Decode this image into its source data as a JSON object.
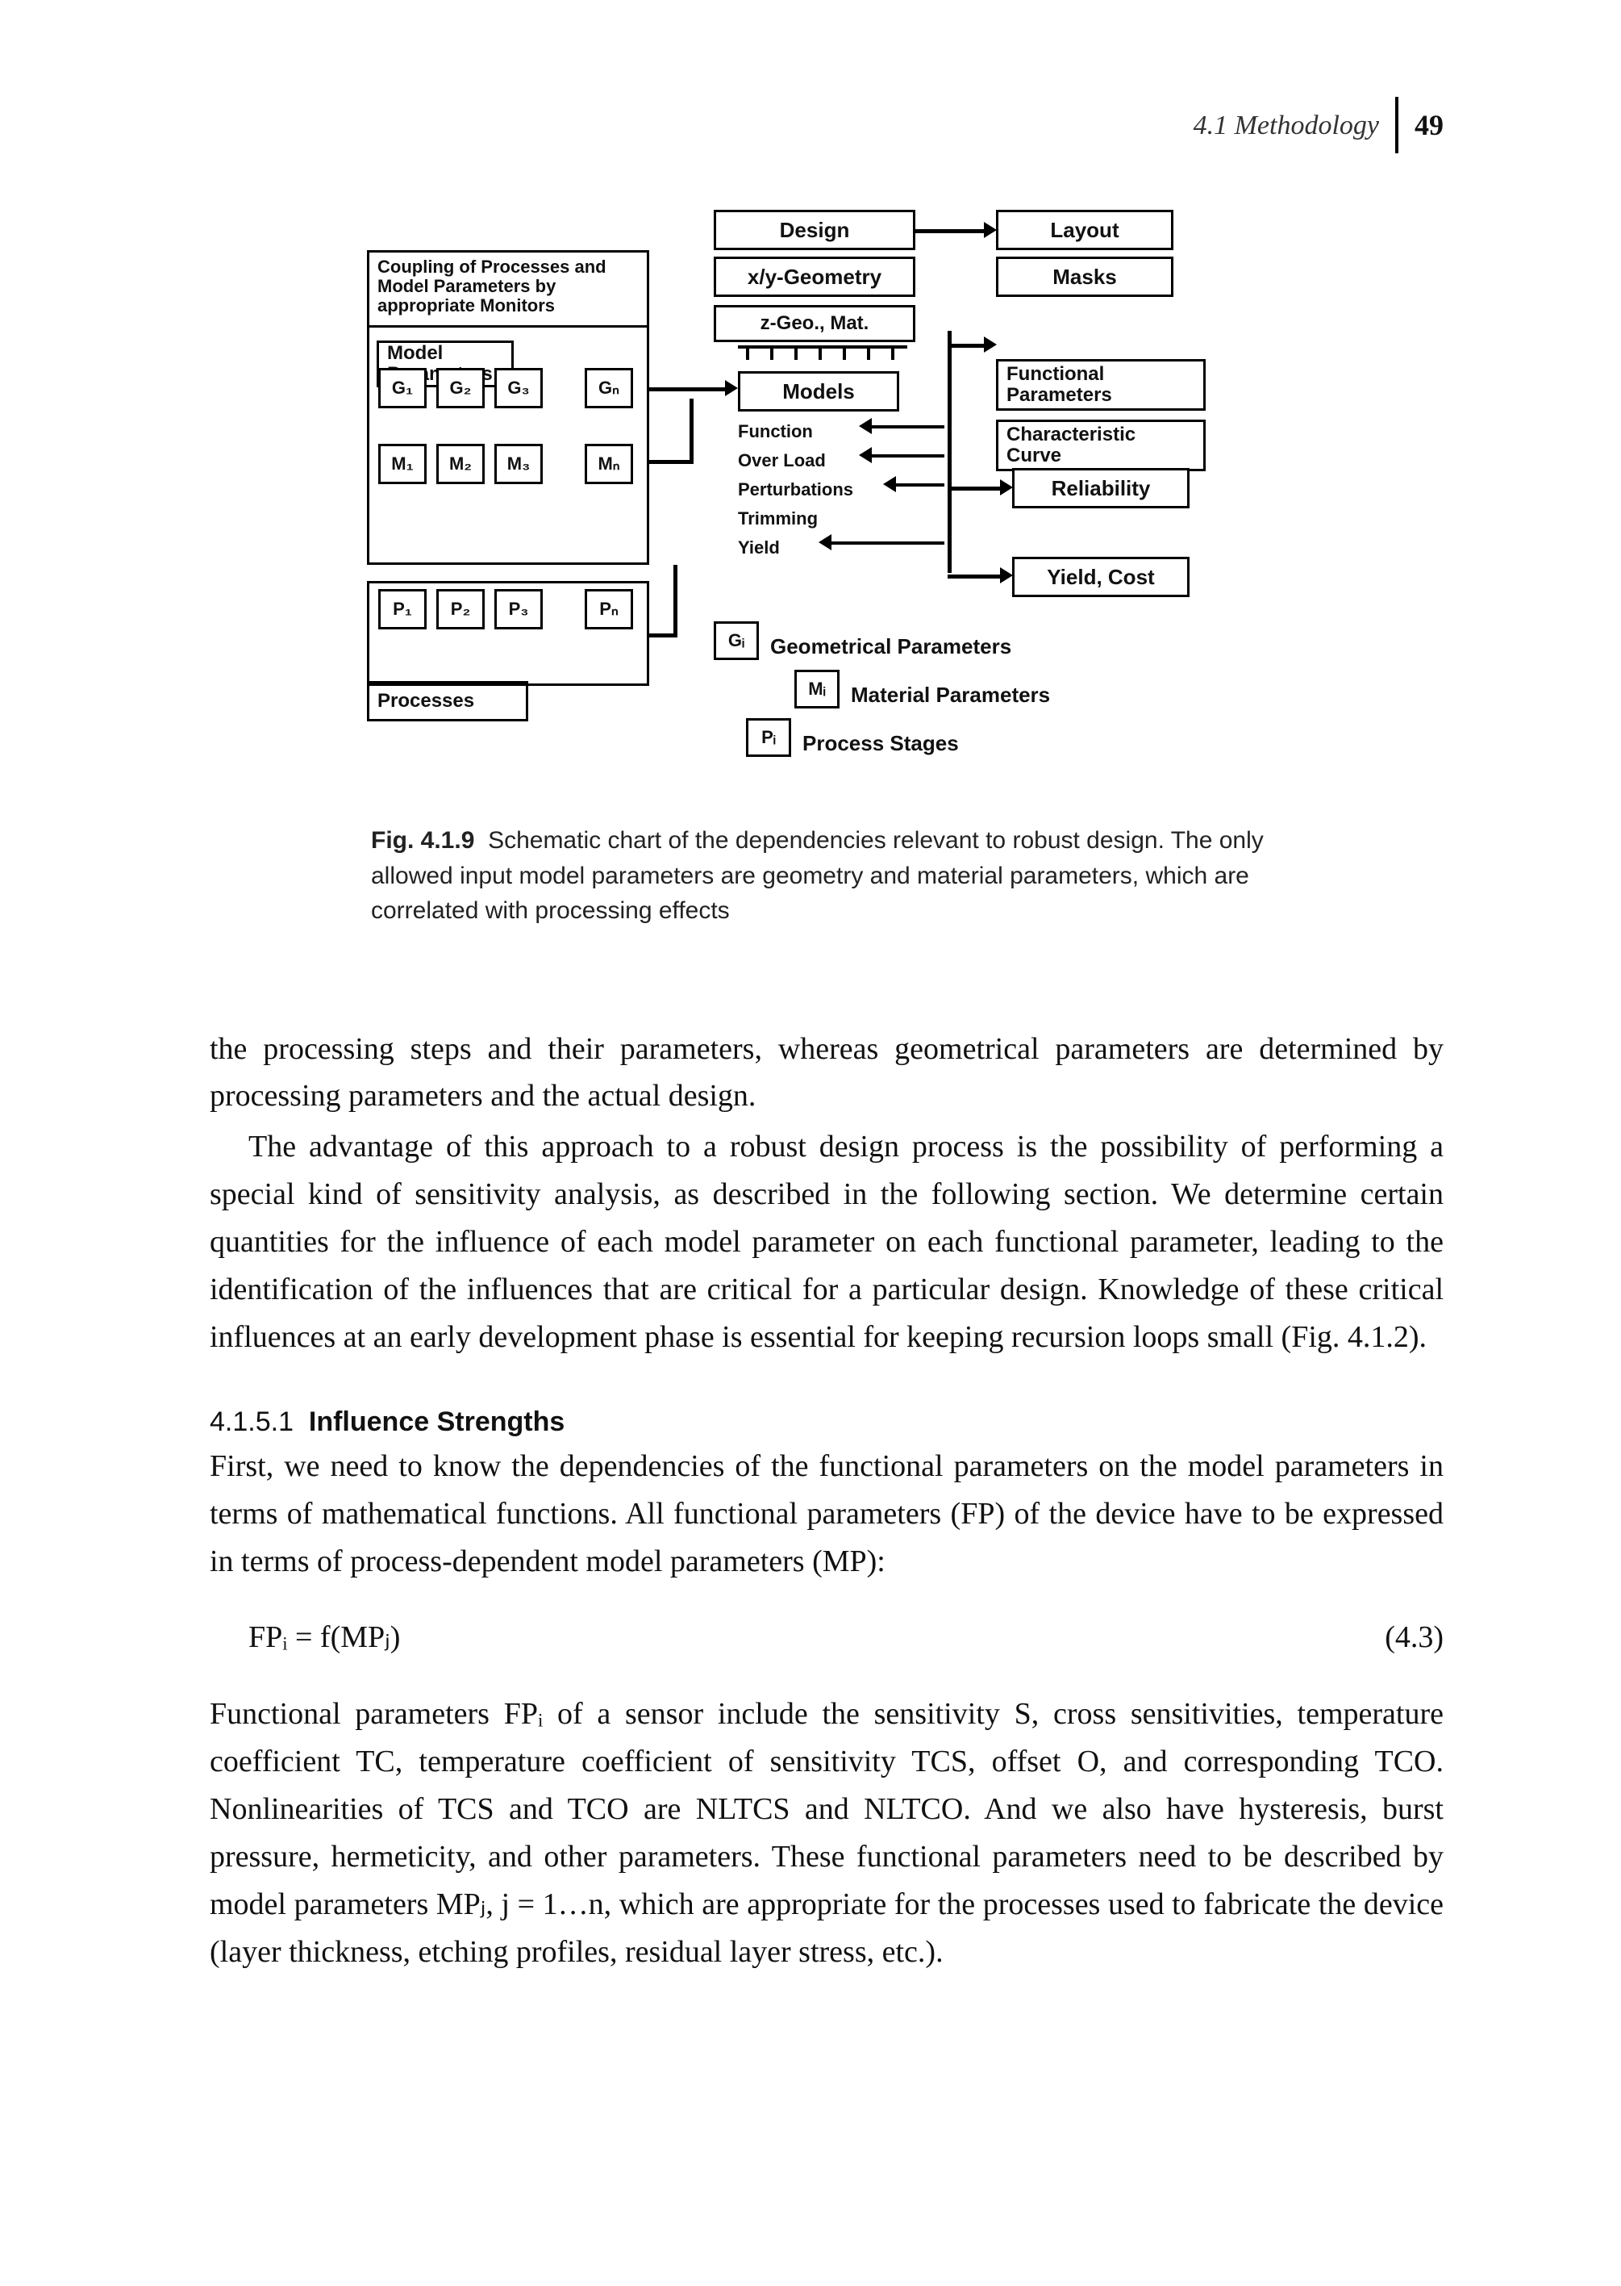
{
  "header": {
    "section": "4.1 Methodology",
    "page": "49"
  },
  "figure": {
    "top_left_title": "Coupling of Processes and Model Parameters by appropriate Monitors",
    "design": "Design",
    "layout": "Layout",
    "xy_geo": "x/y-Geometry",
    "masks": "Masks",
    "z_geo": "z-Geo., Mat.",
    "model_params": "Model Parameters",
    "g1": "G₁",
    "g2": "G₂",
    "g3": "G₃",
    "gn": "Gₙ",
    "m1": "M₁",
    "m2": "M₂",
    "m3": "M₃",
    "mn": "Mₙ",
    "p1": "P₁",
    "p2": "P₂",
    "p3": "P₃",
    "pn": "Pₙ",
    "processes": "Processes",
    "models": "Models",
    "function": "Function",
    "overload": "Over Load",
    "perturb": "Perturbations",
    "trimming": "Trimming",
    "yield": "Yield",
    "func_params": "Functional Parameters",
    "char_curve": "Characteristic Curve",
    "reliability": "Reliability",
    "yield_cost": "Yield, Cost",
    "gi": "Gᵢ",
    "gp": "Geometrical Parameters",
    "mi": "Mᵢ",
    "mp": "Material Parameters",
    "pi": "Pᵢ",
    "ps": "Process Stages"
  },
  "caption": {
    "label": "Fig. 4.1.9",
    "text": "Schematic chart of the dependencies relevant to robust design. The only allowed input model parameters are geometry and material parameters, which are correlated with processing effects"
  },
  "body": {
    "p1": "the processing steps and their parameters, whereas geometrical parameters are determined by processing parameters and the actual design.",
    "p2": "The advantage of this approach to a robust design process is the possibility of performing a special kind of sensitivity analysis, as described in the following section. We determine certain quantities for the influence of each model parameter on each functional parameter, leading to the identification of the influences that are critical for a particular design. Knowledge of these critical influences at an early development phase is essential for keeping recursion loops small (Fig. 4.1.2)."
  },
  "subsection": {
    "num": "4.1.5.1",
    "title": "Influence Strengths",
    "p1": "First, we need to know the dependencies of the functional parameters on the model parameters in terms of mathematical functions. All functional parameters (FP) of the device have to be expressed in terms of process-dependent model parameters (MP):",
    "eq": "FPᵢ = f(MPⱼ)",
    "eqnum": "(4.3)",
    "p2": "Functional parameters FPᵢ of a sensor include the sensitivity S, cross sensitivities, temperature coefficient TC, temperature coefficient of sensitivity TCS, offset O, and corresponding TCO. Nonlinearities of TCS and TCO are NLTCS and NLTCO. And we also have hysteresis, burst pressure, hermeticity, and other parameters. These functional parameters need to be described by model parameters MPⱼ, j = 1…n, which are appropriate for the processes used to fabricate the device (layer thickness, etching profiles, residual layer stress, etc.)."
  }
}
